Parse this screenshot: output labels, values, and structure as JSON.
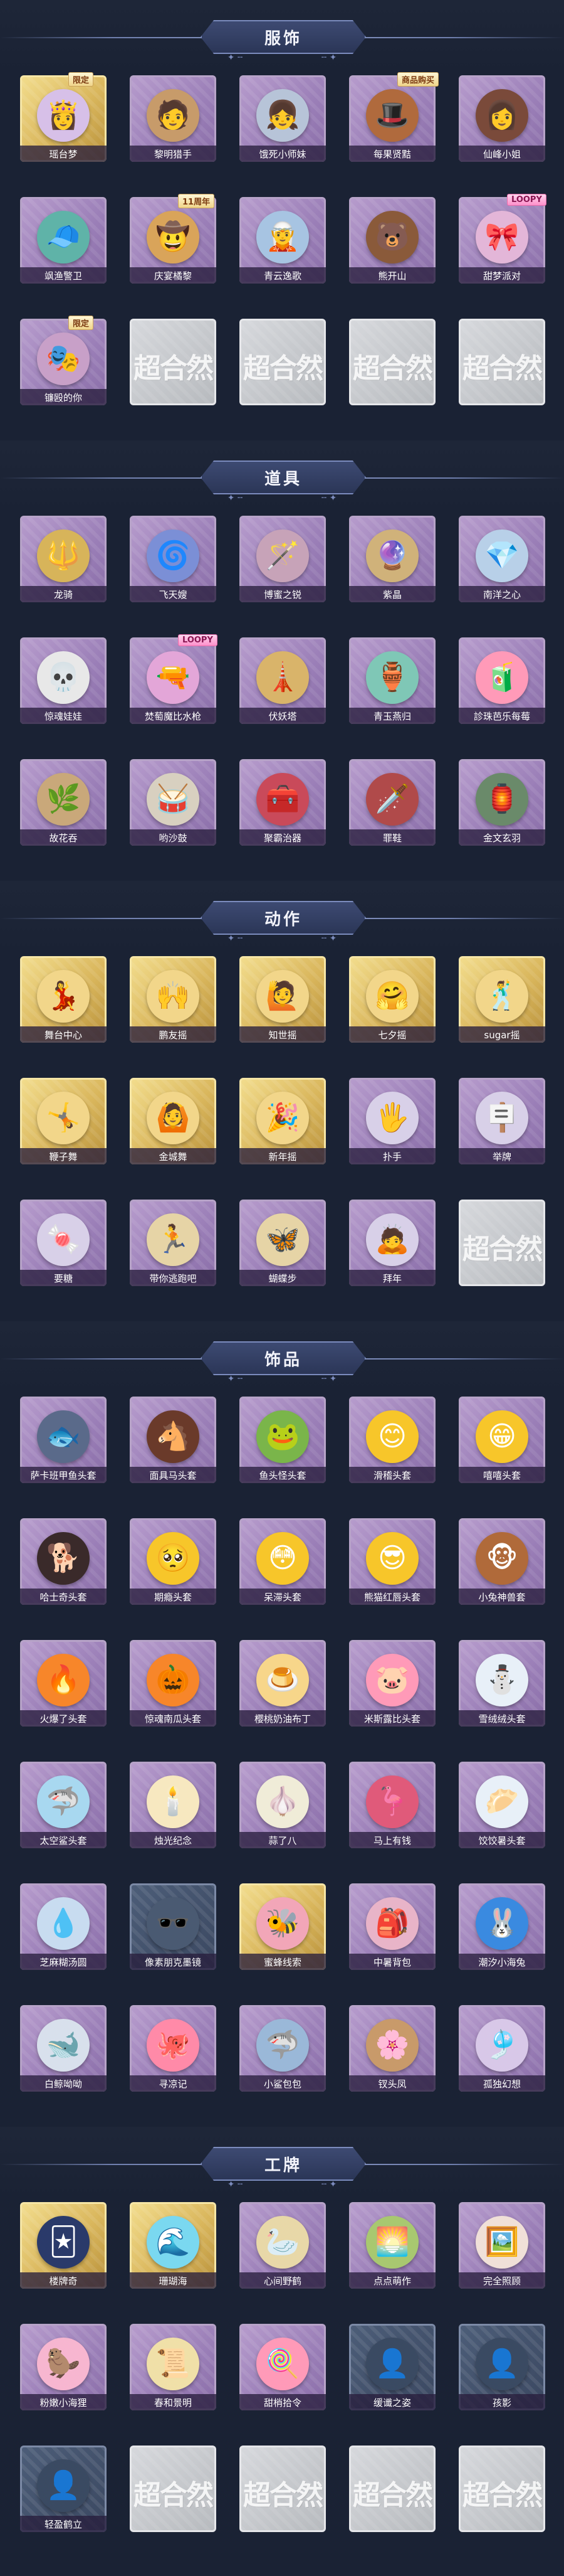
{
  "sections": [
    {
      "title": "服饰",
      "items": [
        {
          "label": "瑶台梦",
          "style": "gold",
          "badge": "限定",
          "icon": "👸",
          "color": "#d7c0e8"
        },
        {
          "label": "黎明猎手",
          "style": "purple",
          "icon": "🧑",
          "color": "#c79b6a"
        },
        {
          "label": "饿死小师妹",
          "style": "purple",
          "icon": "👧",
          "color": "#b7c4d8"
        },
        {
          "label": "每果贤黠",
          "style": "purple",
          "badge": "商品购买",
          "icon": "🎩",
          "color": "#b06a3d"
        },
        {
          "label": "仙峰小姐",
          "style": "purple",
          "icon": "👩",
          "color": "#7a4a3a"
        },
        {
          "label": "飒渔警卫",
          "style": "purple",
          "icon": "🧢",
          "color": "#5fb3a8"
        },
        {
          "label": "庆宴橘黎",
          "style": "purple",
          "badge": "11周年",
          "icon": "🤠",
          "color": "#d9a45a"
        },
        {
          "label": "青云逸歌",
          "style": "purple",
          "icon": "🧝",
          "color": "#a7c4e2"
        },
        {
          "label": "熊开山",
          "style": "purple",
          "icon": "🐻",
          "color": "#8a5a3a"
        },
        {
          "label": "甜梦派对",
          "style": "purple",
          "badge": "LOOPY",
          "badge_style": "loopy",
          "icon": "🎀",
          "color": "#e3b6d8"
        },
        {
          "label": "镰殴的你",
          "style": "purple",
          "badge": "限定",
          "icon": "🎭",
          "color": "#c8a0c8"
        },
        {
          "label": "",
          "style": "empty",
          "placeholder": "超合然"
        },
        {
          "label": "",
          "style": "empty",
          "placeholder": "超合然"
        },
        {
          "label": "",
          "style": "empty",
          "placeholder": "超合然"
        },
        {
          "label": "",
          "style": "empty",
          "placeholder": "超合然"
        }
      ]
    },
    {
      "title": "道具",
      "items": [
        {
          "label": "龙骑",
          "style": "purple",
          "icon": "🔱",
          "color": "#d7b45a"
        },
        {
          "label": "飞天嫂",
          "style": "purple",
          "icon": "🌀",
          "color": "#7b8fd6"
        },
        {
          "label": "博蜜之锐",
          "style": "purple",
          "icon": "🪄",
          "color": "#c7a3b8"
        },
        {
          "label": "紫晶",
          "style": "purple",
          "icon": "🔮",
          "color": "#d0b27a"
        },
        {
          "label": "南洋之心",
          "style": "purple",
          "icon": "💎",
          "color": "#b8d0e8"
        },
        {
          "label": "惊魂娃娃",
          "style": "purple",
          "icon": "💀",
          "color": "#e8e8e8"
        },
        {
          "label": "焚萄魔比水枪",
          "style": "purple",
          "badge": "LOOPY",
          "badge_style": "loopy",
          "icon": "🔫",
          "color": "#e3a6d8"
        },
        {
          "label": "伏妖塔",
          "style": "purple",
          "icon": "🗼",
          "color": "#d9b46a"
        },
        {
          "label": "青玉燕归",
          "style": "purple",
          "icon": "🏺",
          "color": "#7fc7b6"
        },
        {
          "label": "診珠芭乐每莓",
          "style": "purple",
          "icon": "🧃",
          "color": "#ff9ab8"
        },
        {
          "label": "故花吞",
          "style": "purple",
          "icon": "🌿",
          "color": "#c9a87a"
        },
        {
          "label": "哟沙鼓",
          "style": "purple",
          "icon": "🥁",
          "color": "#d8d0c0"
        },
        {
          "label": "聚霸治器",
          "style": "purple",
          "icon": "🧰",
          "color": "#c94a5a"
        },
        {
          "label": "罪鞋",
          "style": "purple",
          "icon": "🗡️",
          "color": "#b04a4a"
        },
        {
          "label": "金文玄羽",
          "style": "purple",
          "icon": "🏮",
          "color": "#6a8a6a"
        }
      ]
    },
    {
      "title": "动作",
      "items": [
        {
          "label": "舞台中心",
          "style": "gold",
          "icon": "💃",
          "color": "#f2d68a"
        },
        {
          "label": "鹏友摇",
          "style": "gold",
          "icon": "🙌",
          "color": "#f2d68a"
        },
        {
          "label": "知世摇",
          "style": "gold",
          "icon": "🙋",
          "color": "#f2d68a"
        },
        {
          "label": "七夕摇",
          "style": "gold",
          "icon": "🤗",
          "color": "#f2d68a"
        },
        {
          "label": "sugar摇",
          "style": "gold",
          "icon": "🕺",
          "color": "#f2d68a"
        },
        {
          "label": "鞭子舞",
          "style": "gold",
          "icon": "🤸",
          "color": "#f2d68a"
        },
        {
          "label": "金城舞",
          "style": "gold",
          "icon": "🙆",
          "color": "#f2d68a"
        },
        {
          "label": "新年摇",
          "style": "gold",
          "icon": "🎉",
          "color": "#f2d68a"
        },
        {
          "label": "扑手",
          "style": "purple",
          "icon": "🖐️",
          "color": "#d8d0e8"
        },
        {
          "label": "举牌",
          "style": "purple",
          "icon": "🪧",
          "color": "#d8d0e8"
        },
        {
          "label": "要糖",
          "style": "purple",
          "icon": "🍬",
          "color": "#d8d0e8"
        },
        {
          "label": "带你逃跑吧",
          "style": "purple",
          "icon": "🏃",
          "color": "#e6d4a6"
        },
        {
          "label": "蝴蝶步",
          "style": "purple",
          "icon": "🦋",
          "color": "#e6d4a6"
        },
        {
          "label": "拜年",
          "style": "purple",
          "icon": "🙇",
          "color": "#d8d0e8"
        },
        {
          "label": "",
          "style": "empty",
          "placeholder": "超合然"
        }
      ]
    },
    {
      "title": "饰品",
      "items": [
        {
          "label": "萨卡班甲鱼头套",
          "style": "purple",
          "icon": "🐟",
          "color": "#5a6a8a"
        },
        {
          "label": "面具马头套",
          "style": "purple",
          "icon": "🐴",
          "color": "#6a3a2a"
        },
        {
          "label": "鱼头怪头套",
          "style": "purple",
          "icon": "🐸",
          "color": "#7ab54a"
        },
        {
          "label": "滑稽头套",
          "style": "purple",
          "icon": "😊",
          "color": "#f7c62a"
        },
        {
          "label": "嘻嘻头套",
          "style": "purple",
          "icon": "😁",
          "color": "#f7c62a"
        },
        {
          "label": "哈士奇头套",
          "style": "purple",
          "icon": "🐕",
          "color": "#3a2a2a"
        },
        {
          "label": "期瘾头套",
          "style": "purple",
          "icon": "🥺",
          "color": "#f7c62a"
        },
        {
          "label": "呆滞头套",
          "style": "purple",
          "icon": "😳",
          "color": "#f7c62a"
        },
        {
          "label": "熊猫红唇头套",
          "style": "purple",
          "icon": "😎",
          "color": "#f7c62a"
        },
        {
          "label": "小兔神兽套",
          "style": "purple",
          "icon": "🐵",
          "color": "#b06a3a"
        },
        {
          "label": "火爆了头套",
          "style": "purple",
          "icon": "🔥",
          "color": "#f7862a"
        },
        {
          "label": "惊魂南瓜头套",
          "style": "purple",
          "icon": "🎃",
          "color": "#f7862a"
        },
        {
          "label": "樱桃奶油布丁",
          "style": "purple",
          "icon": "🍮",
          "color": "#f7d68a"
        },
        {
          "label": "米斯露比头套",
          "style": "purple",
          "icon": "🐷",
          "color": "#ff9ab8"
        },
        {
          "label": "雪绒绒头套",
          "style": "purple",
          "icon": "⛄",
          "color": "#e8f0f8"
        },
        {
          "label": "太空鲨头套",
          "style": "purple",
          "icon": "🦈",
          "color": "#a8d8f0"
        },
        {
          "label": "烛光纪念",
          "style": "purple",
          "icon": "🕯️",
          "color": "#f7e8c0"
        },
        {
          "label": "蒜了八",
          "style": "purple",
          "icon": "🧄",
          "color": "#f0ecd8"
        },
        {
          "label": "马上有钱",
          "style": "purple",
          "icon": "🦩",
          "color": "#e05a7a"
        },
        {
          "label": "饺饺暑头套",
          "style": "purple",
          "icon": "🥟",
          "color": "#e8f0f8"
        },
        {
          "label": "芝麻糊汤圆",
          "style": "purple",
          "icon": "💧",
          "color": "#c8dcf0"
        },
        {
          "label": "像素朋克墨镜",
          "style": "dark",
          "icon": "🕶️",
          "color": "#4a5a72"
        },
        {
          "label": "蜜蜂线索",
          "style": "gold",
          "icon": "🐝",
          "color": "#f2a6b8"
        },
        {
          "label": "中暑背包",
          "style": "purple",
          "icon": "🎒",
          "color": "#e8b4c8"
        },
        {
          "label": "潮汐小海兔",
          "style": "purple",
          "icon": "🐰",
          "color": "#3a8ae0"
        },
        {
          "label": "白鲸呦呦",
          "style": "purple",
          "icon": "🐋",
          "color": "#d8e0ec"
        },
        {
          "label": "寻凉记",
          "style": "purple",
          "icon": "🐙",
          "color": "#ff8aa8"
        },
        {
          "label": "小鲨包包",
          "style": "purple",
          "icon": "🦈",
          "color": "#9ab8d8"
        },
        {
          "label": "钗头凤",
          "style": "purple",
          "icon": "🌸",
          "color": "#c89a6a"
        },
        {
          "label": "孤独幻想",
          "style": "purple",
          "icon": "🎐",
          "color": "#d8c8e8"
        }
      ]
    },
    {
      "title": "工牌",
      "items": [
        {
          "label": "楼牌奇",
          "style": "gold",
          "icon": "🃏",
          "color": "#2a3a6a"
        },
        {
          "label": "珊瑚海",
          "style": "gold",
          "icon": "🌊",
          "color": "#7ad8f0"
        },
        {
          "label": "心间野鹤",
          "style": "purple",
          "icon": "🦢",
          "color": "#e8d8a8"
        },
        {
          "label": "点点萌作",
          "style": "purple",
          "icon": "🌅",
          "color": "#a8c870"
        },
        {
          "label": "完全照顾",
          "style": "purple",
          "icon": "🖼️",
          "color": "#f0e0d8"
        },
        {
          "label": "粉嫩小海狸",
          "style": "purple",
          "icon": "🦫",
          "color": "#f7b6d0"
        },
        {
          "label": "春和景明",
          "style": "purple",
          "icon": "📜",
          "color": "#f0e0a8"
        },
        {
          "label": "甜梢拾令",
          "style": "purple",
          "icon": "🍭",
          "color": "#ff9ab8"
        },
        {
          "label": "缓谶之姿",
          "style": "dark",
          "icon": "👤",
          "color": "#3a4a62"
        },
        {
          "label": "孩影",
          "style": "dark",
          "icon": "👤",
          "color": "#3a4a62"
        },
        {
          "label": "轻盈鹤立",
          "style": "dark",
          "icon": "👤",
          "color": "#3a4a62"
        },
        {
          "label": "",
          "style": "empty",
          "placeholder": "超合然"
        },
        {
          "label": "",
          "style": "empty",
          "placeholder": "超合然"
        },
        {
          "label": "",
          "style": "empty",
          "placeholder": "超合然"
        },
        {
          "label": "",
          "style": "empty",
          "placeholder": "超合然"
        }
      ]
    }
  ]
}
